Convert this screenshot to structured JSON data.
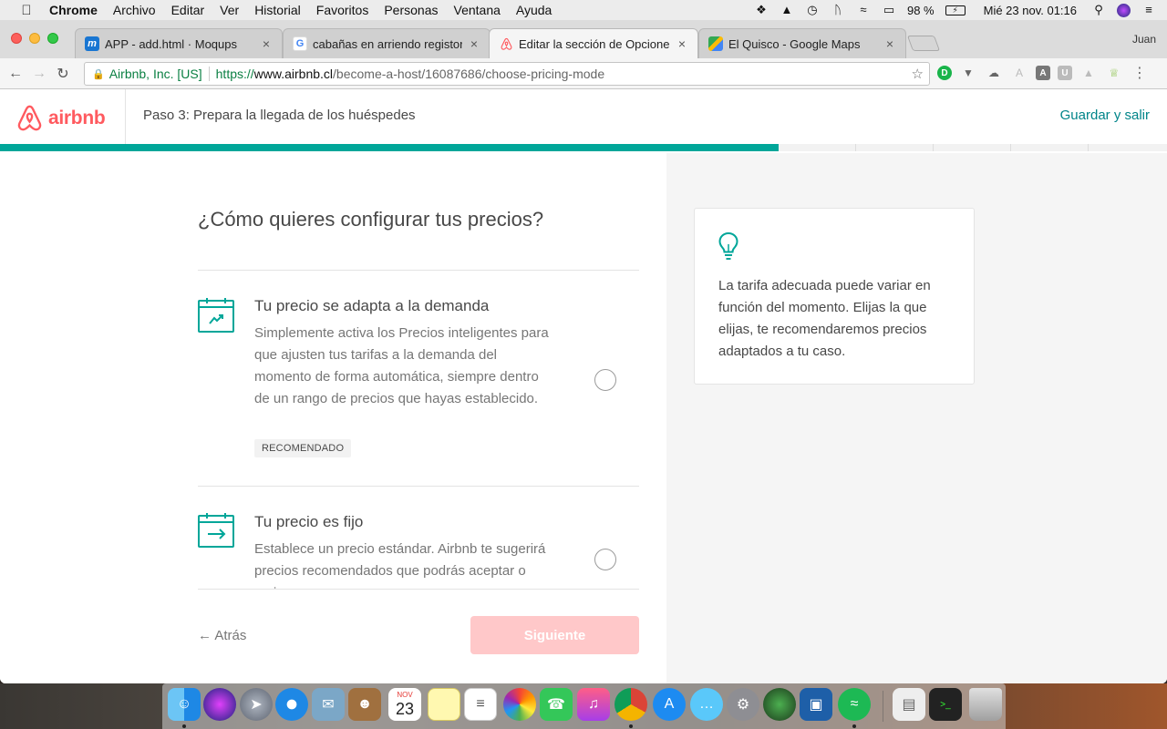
{
  "menubar": {
    "app_name": "Chrome",
    "items": [
      "Archivo",
      "Editar",
      "Ver",
      "Historial",
      "Favoritos",
      "Personas",
      "Ventana",
      "Ayuda"
    ],
    "battery": "98 %",
    "datetime": "Mié 23 nov.  01:16"
  },
  "browser": {
    "tabs": [
      {
        "title": "APP - add.html · Moqups",
        "favicon": "moqups-icon",
        "favicon_text": "m"
      },
      {
        "title": "cabañas en arriendo registor -",
        "favicon": "google-icon",
        "favicon_text": "G"
      },
      {
        "title": "Editar la sección de Opciones d",
        "favicon": "airbnb-icon",
        "favicon_text": ""
      },
      {
        "title": "El Quisco - Google Maps",
        "favicon": "google-maps-icon",
        "favicon_text": ""
      }
    ],
    "active_tab": 2,
    "profile_name": "Juan",
    "address_bar": {
      "site_identity": "Airbnb, Inc. [US]",
      "url_scheme": "https://",
      "url_host": "www.airbnb.cl",
      "url_path": "/become-a-host/16087686/choose-pricing-mode"
    }
  },
  "airbnb": {
    "logo_text": "airbnb",
    "step_title": "Paso 3: Prepara la llegada de los huéspedes",
    "save_exit": "Guardar y salir",
    "progress": 0.667,
    "question": "¿Cómo quieres configurar tus precios?",
    "options": [
      {
        "title": "Tu precio se adapta a la demanda",
        "description": "Simplemente activa los Precios inteligentes para que ajusten tus tarifas a la demanda del momento de forma automática, siempre dentro de un rango de precios que hayas establecido.",
        "badge": "RECOMENDADO",
        "selected": false
      },
      {
        "title": "Tu precio es fijo",
        "description": "Establece un precio estándar. Airbnb te sugerirá precios recomendados que podrás aceptar o rechazar.",
        "selected": false
      }
    ],
    "tip_text": "La tarifa adecuada puede variar en función del momento. Elijas la que elijas, te recomendaremos precios adaptados a tu caso.",
    "back_label": "← Atrás",
    "next_label": "Siguiente",
    "colors": {
      "brand": "#ff5a5f",
      "teal": "#008489",
      "progress": "#00a699"
    }
  },
  "dock": {
    "apps": [
      "finder-icon",
      "siri-icon",
      "launchpad-icon",
      "safari-icon",
      "mail-icon",
      "contacts-icon",
      "calendar-icon",
      "notes-icon",
      "reminders-icon",
      "photos-icon",
      "facetime-icon",
      "itunes-icon",
      "chrome-icon",
      "app-store-icon",
      "messages-icon",
      "system-preferences-icon",
      "google-earth-icon",
      "sourcetree-icon",
      "spotify-icon",
      "downloads-stack-icon",
      "terminal-icon",
      "trash-icon"
    ],
    "calendar_month": "NOV",
    "calendar_day": "23"
  }
}
